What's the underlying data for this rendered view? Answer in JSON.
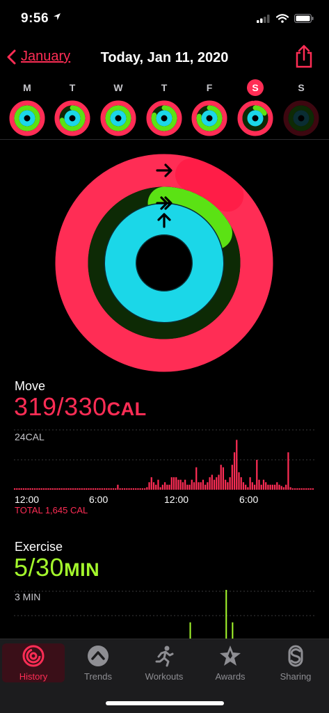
{
  "status": {
    "time": "9:56"
  },
  "nav": {
    "back_label": "January",
    "title": "Today, Jan 11, 2020"
  },
  "week": {
    "days": [
      "M",
      "T",
      "W",
      "T",
      "F",
      "S",
      "S"
    ],
    "today_index": 5
  },
  "colors": {
    "move": "#ff2d55",
    "exercise": "#a4f82c",
    "stand": "#22e0f0",
    "background": "#000000"
  },
  "move": {
    "label": "Move",
    "value": "319/330",
    "unit": "CAL",
    "chart_max_label": "24CAL",
    "x_ticks": [
      "12:00",
      "6:00",
      "12:00",
      "6:00"
    ],
    "total": "TOTAL 1,645 CAL"
  },
  "exercise": {
    "label": "Exercise",
    "value": "5/30",
    "unit": "MIN",
    "chart_max_label": "3 MIN"
  },
  "chart_data": [
    {
      "type": "bar",
      "title": "Move",
      "ylabel": "CAL",
      "ylim": [
        0,
        24
      ],
      "x_tick_labels": [
        "12:00",
        "6:00",
        "12:00",
        "6:00"
      ],
      "values": [
        0.5,
        0.5,
        0.5,
        0.5,
        0.5,
        0.5,
        0.5,
        0.5,
        0.5,
        0.5,
        0.5,
        0.5,
        0.5,
        0.5,
        0.5,
        0.5,
        0.5,
        0.5,
        0.5,
        0.5,
        0.5,
        0.5,
        0.5,
        0.5,
        0.5,
        0.5,
        0.5,
        0.5,
        0.5,
        0.5,
        0.5,
        0.5,
        0.5,
        0.5,
        0.5,
        0.5,
        0.5,
        0.5,
        0.5,
        0.5,
        0.5,
        0.5,
        0.5,
        0.5,
        0.5,
        0.5,
        2,
        0.5,
        0.5,
        0.5,
        0.5,
        0.5,
        0.5,
        0.5,
        0.5,
        0.5,
        0.5,
        0.5,
        0.5,
        1,
        3,
        5,
        3,
        2,
        4,
        1,
        2,
        3,
        2,
        2,
        5,
        5,
        5,
        4,
        4,
        3,
        4,
        2,
        2,
        4,
        3,
        9,
        3,
        3,
        4,
        2,
        3,
        5,
        6,
        4,
        5,
        6,
        10,
        9,
        4,
        3,
        5,
        10,
        15,
        20,
        7,
        5,
        3,
        2,
        1,
        5,
        3,
        2,
        12,
        4,
        2,
        4,
        3,
        2,
        2,
        2,
        2,
        3,
        2,
        1.5,
        1,
        2,
        15,
        1,
        0.5,
        0.5,
        0.5,
        0.5,
        0.5,
        0.5,
        0.5,
        0.5,
        0.5,
        0.5
      ]
    },
    {
      "type": "bar",
      "title": "Exercise",
      "ylabel": "MIN",
      "ylim": [
        0,
        3
      ],
      "values": [
        0,
        0,
        0,
        0,
        0,
        0,
        0,
        0,
        0,
        0,
        0,
        0,
        0,
        0,
        0,
        0,
        0,
        0,
        0,
        0,
        0,
        0,
        0,
        0,
        0,
        0,
        0,
        0,
        0,
        0,
        0,
        0,
        0,
        0,
        0,
        0,
        0,
        0,
        0,
        0,
        0,
        0,
        0,
        0,
        0,
        0,
        0,
        0,
        0,
        0,
        0,
        0,
        0,
        0,
        0,
        0,
        0,
        0,
        0,
        0,
        0,
        0,
        0,
        0,
        0,
        0,
        0,
        0,
        0,
        0,
        0,
        0,
        0,
        0,
        0,
        0,
        0,
        0,
        0,
        0,
        0,
        0,
        0,
        1,
        0,
        0,
        0,
        0,
        0,
        0,
        0,
        0,
        0,
        0,
        0,
        0,
        0,
        0,
        0,
        0,
        3,
        0,
        0,
        1,
        0,
        0,
        0,
        0,
        0,
        0,
        0,
        0,
        0,
        0,
        0,
        0,
        0,
        0,
        0,
        0,
        0,
        0,
        0,
        0,
        0,
        0,
        0,
        0,
        0,
        0,
        0,
        0,
        0,
        0,
        0,
        0,
        0,
        0,
        0,
        0,
        0,
        0
      ]
    }
  ],
  "tabs": [
    {
      "label": "History",
      "icon": "history-icon",
      "active": true
    },
    {
      "label": "Trends",
      "icon": "trends-icon",
      "active": false
    },
    {
      "label": "Workouts",
      "icon": "workouts-icon",
      "active": false
    },
    {
      "label": "Awards",
      "icon": "awards-icon",
      "active": false
    },
    {
      "label": "Sharing",
      "icon": "sharing-icon",
      "active": false
    }
  ]
}
